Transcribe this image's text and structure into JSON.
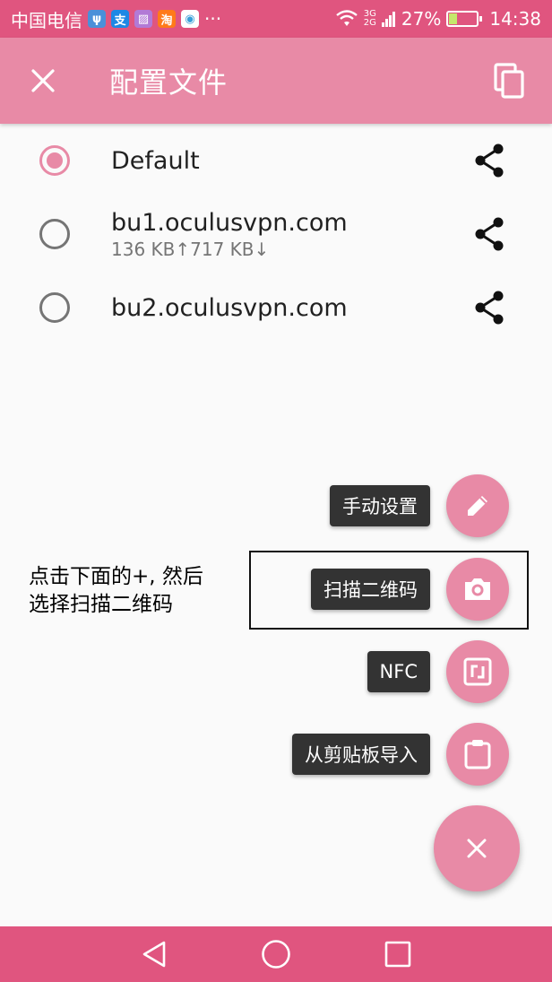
{
  "status_bar": {
    "carrier": "中国电信",
    "app_icons": [
      {
        "name": "usb-icon",
        "glyph": "ψ",
        "color": "#4a90d9"
      },
      {
        "name": "alipay-icon",
        "glyph": "支",
        "color": "#1e88e5"
      },
      {
        "name": "gallery-icon",
        "glyph": "▨",
        "color": "#b27ad6"
      },
      {
        "name": "taobao-icon",
        "glyph": "淘",
        "color": "#ff7a1a"
      },
      {
        "name": "browser-icon",
        "glyph": "◉",
        "color": "#3aa0d8"
      }
    ],
    "more": "···",
    "network_top": "3G",
    "network_bottom": "2G",
    "battery": "27%",
    "time": "14:38"
  },
  "toolbar": {
    "title": "配置文件"
  },
  "profiles": [
    {
      "name": "Default",
      "stats": "",
      "selected": true
    },
    {
      "name": "bu1.oculusvpn.com",
      "stats": "136 KB↑717 KB↓",
      "selected": false
    },
    {
      "name": "bu2.oculusvpn.com",
      "stats": "",
      "selected": false
    }
  ],
  "fab_menu": {
    "manual": "手动设置",
    "scan_qr": "扫描二维码",
    "nfc": "NFC",
    "clipboard": "从剪贴板导入"
  },
  "annotation": {
    "line1": "点击下面的+, 然后",
    "line2": "选择扫描二维码"
  },
  "colors": {
    "accent": "#e88aa6",
    "status_bar": "#e0557f",
    "label_bg": "#333333"
  }
}
